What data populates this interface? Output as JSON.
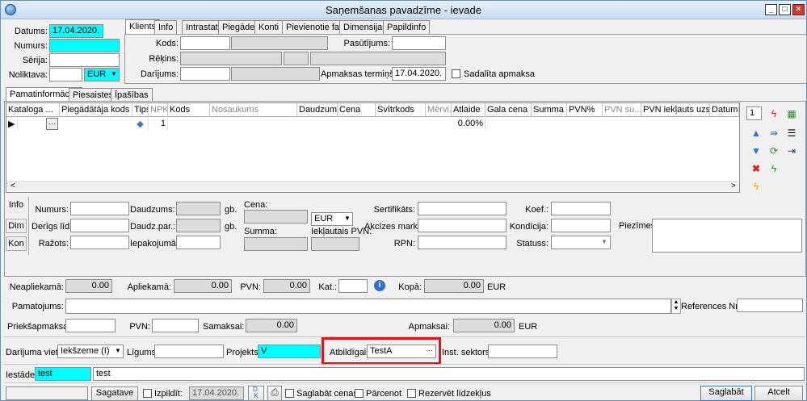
{
  "window": {
    "title": "Saņemšanas pavadzīme - ievade"
  },
  "header": {
    "datums_label": "Datums:",
    "datums_value": "17.04.2020.",
    "numurs_label": "Numurs:",
    "numurs_value": "",
    "serija_label": "Sērija:",
    "serija_value": "",
    "noliktava_label": "Noliktava:",
    "noliktava_value": "",
    "currency_value": "EUR"
  },
  "top_tabs": [
    "Klients",
    "Info",
    "Intrastat",
    "Piegāde",
    "Konti",
    "Pievienotie faili",
    "Dimensijas",
    "Papildinfo"
  ],
  "client": {
    "kods_label": "Kods:",
    "pasutijums_label": "Pasūtījums:",
    "rekins_label": "Rēķins:",
    "darijums_label": "Darījums:",
    "apmaksas_label": "Apmaksas termiņš:",
    "apmaksas_value": "17.04.2020.",
    "sadalita_label": "Sadalīta apmaksa"
  },
  "main_tabs": [
    "Pamatinformācija",
    "Piesaistes",
    "Īpašības"
  ],
  "grid": {
    "columns": [
      "Kataloga ...",
      "Piegādātāja kods",
      "Tips",
      "NPK",
      "Kods",
      "Nosaukums",
      "Daudzums",
      "Cena",
      "Svītrkods",
      "Mērvi...",
      "Atlaide",
      "Gala cena",
      "Summa",
      "PVN%",
      "PVN su...",
      "PVN iekļauts uzsk...",
      "Datums"
    ],
    "row": {
      "npk": "1",
      "atlaide": "0.00%"
    },
    "page_value": "1"
  },
  "detail": {
    "side_tabs": [
      "Info",
      "Dim",
      "Kon"
    ],
    "numurs_label": "Numurs:",
    "derigs_label": "Derīgs līdz:",
    "razots_label": "Ražots:",
    "daudzums_label": "Daudzums:",
    "daudzpar_label": "Daudz.par.:",
    "iepakojuma_label": "Iepakojumā:",
    "gb1": "gb.",
    "gb2": "gb.",
    "cena_label": "Cena:",
    "summa_label": "Summa:",
    "currency": "EUR",
    "ieklautais_label": "Iekļautais PVN:",
    "sertifikats_label": "Sertifikāts:",
    "akcizes_label": "Akcīzes marka:",
    "rpn_label": "RPN:",
    "koef_label": "Koef.:",
    "kondicija_label": "Kondīcija:",
    "statuss_label": "Statuss:",
    "piezimes_label": "Piezīmes:"
  },
  "totals": {
    "neapliekama_label": "Neapliekamā:",
    "neapliekama_value": "0.00",
    "apliekama_label": "Apliekamā:",
    "apliekama_value": "0.00",
    "pvn_label": "PVN:",
    "pvn_value": "0.00",
    "kat_label": "Kat.:",
    "kopa_label": "Kopā:",
    "kopa_value": "0.00",
    "kopa_currency": "EUR",
    "pamatojums_label": "Pamatojums:",
    "references_label": "References Nr.:",
    "priekšapmaksa_label": "Priekšapmaksa:",
    "pvn2_label": "PVN:",
    "samaksai_label": "Samaksai:",
    "samaksai_value": "0.00",
    "apmaksai_label": "Apmaksai:",
    "apmaksai_value": "0.00",
    "apmaksai_currency": "EUR"
  },
  "deal": {
    "vieta_label": "Darījuma vieta:",
    "vieta_value": "Iekšzeme (I)",
    "ligums_label": "Līgums:",
    "projekts_label": "Projekts:",
    "projekts_value": "V",
    "atbildigais_label": "Atbildīgais:",
    "atbildigais_value": "TestA",
    "sektors_label": "Inst. sektors:"
  },
  "iestade": {
    "label": "Iestāde:",
    "code": "test",
    "name": "test"
  },
  "footer": {
    "sagatave": "Sagatave",
    "izpildit_label": "Izpildīt:",
    "izpildit_date": "17.04.2020.",
    "saglabat_cenas": "Saglabāt cenas",
    "parcenot": "Pārcenot",
    "rezervet": "Rezervēt līdzekļus",
    "saglabat": "Saglabāt",
    "atcelt": "Atcelt"
  },
  "colors": {
    "highlight": "#e0141e",
    "input_accent": "#00ffff"
  }
}
